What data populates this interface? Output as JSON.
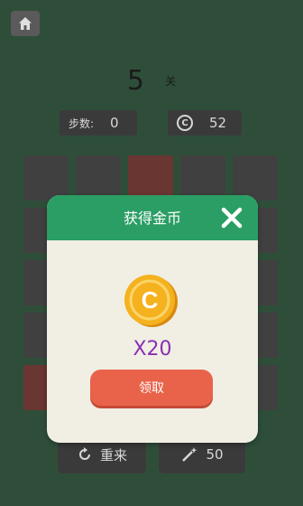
{
  "header": {
    "level_number": "5",
    "level_unit": "关",
    "steps_label": "步数:",
    "steps_value": "0",
    "coin_symbol": "©",
    "coins_value": "52"
  },
  "grid": {
    "rows": 5,
    "cols": 5,
    "red_cells": [
      [
        0,
        2
      ],
      [
        4,
        0
      ]
    ]
  },
  "bottom": {
    "reset_label": "重来",
    "hint_value": "50"
  },
  "modal": {
    "title": "获得金币",
    "coin_letter": "C",
    "reward_text": "X20",
    "claim_label": "领取"
  },
  "colors": {
    "background": "#2f4e3a",
    "modal_header": "#2b9e65",
    "modal_body": "#f1efe4",
    "claim_button": "#e9634a",
    "reward_text": "#8b2fb4",
    "coin_gold": "#f5b21f"
  },
  "icons": {
    "home": "home-icon",
    "close": "close-icon",
    "reset": "refresh-icon",
    "hint": "magic-wand-icon",
    "coin": "coin-icon"
  }
}
